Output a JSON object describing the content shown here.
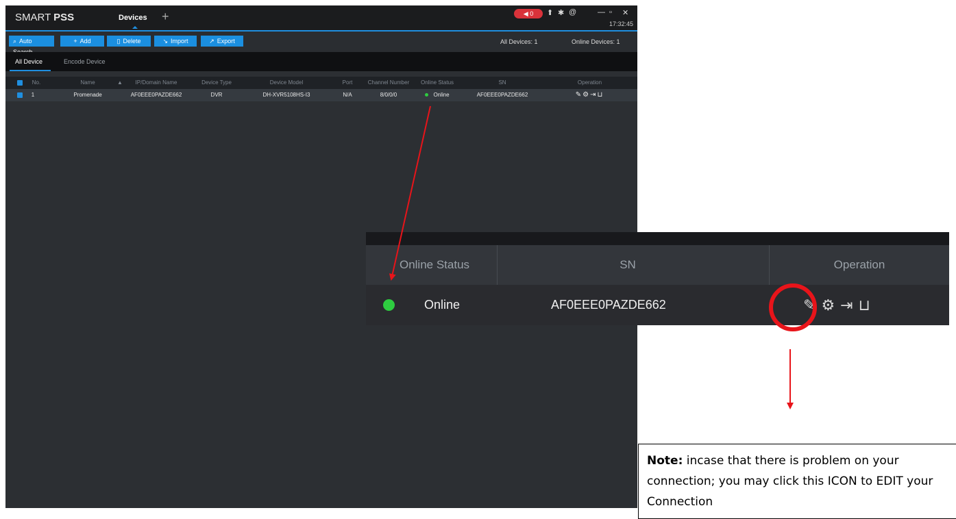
{
  "window": {
    "brand_light": "SMART ",
    "brand_bold": "PSS",
    "active_tab": "Devices",
    "add_tab": "+",
    "alarm_count": "0",
    "clock": "17:32:45"
  },
  "toolbar": {
    "auto_search": "Auto Search",
    "add": "Add",
    "delete": "Delete",
    "import": "Import",
    "export": "Export",
    "all_devices": "All Devices:  1",
    "online_devices": "Online Devices:  1"
  },
  "subtabs": [
    "All Device",
    "Encode Device"
  ],
  "table": {
    "headers": [
      "No.",
      "Name",
      "IP/Domain Name",
      "Device Type",
      "Device Model",
      "Port",
      "Channel Number",
      "Online Status",
      "SN",
      "Operation"
    ],
    "sort_glyph": "▲",
    "rows": [
      {
        "no": "1",
        "name": "Promenade",
        "ip": "AF0EEE0PAZDE662",
        "type": "DVR",
        "model": "DH-XVR5108HS-I3",
        "port": "N/A",
        "channels": "8/0/0/0",
        "status": "Online",
        "sn": "AF0EEE0PAZDE662"
      }
    ]
  },
  "zoom": {
    "headers": [
      "Online Status",
      "SN",
      "Operation"
    ],
    "status": "Online",
    "sn": "AF0EEE0PAZDE662"
  },
  "icons": {
    "edit": "✎",
    "config": "⚙",
    "logout": "⇥",
    "delete": "🗑",
    "search": "⌕",
    "user": "👤",
    "gear": "⚙",
    "minimize": "—",
    "restore": "❐",
    "close": "✕"
  },
  "note": {
    "label": "Note:",
    "text": " incase that there is problem on your connection; you may click this ICON to EDIT your Connection"
  },
  "colors": {
    "accent_blue": "#1f8fe0",
    "online_green": "#2ecc40",
    "annotation_red": "#e8141a"
  }
}
